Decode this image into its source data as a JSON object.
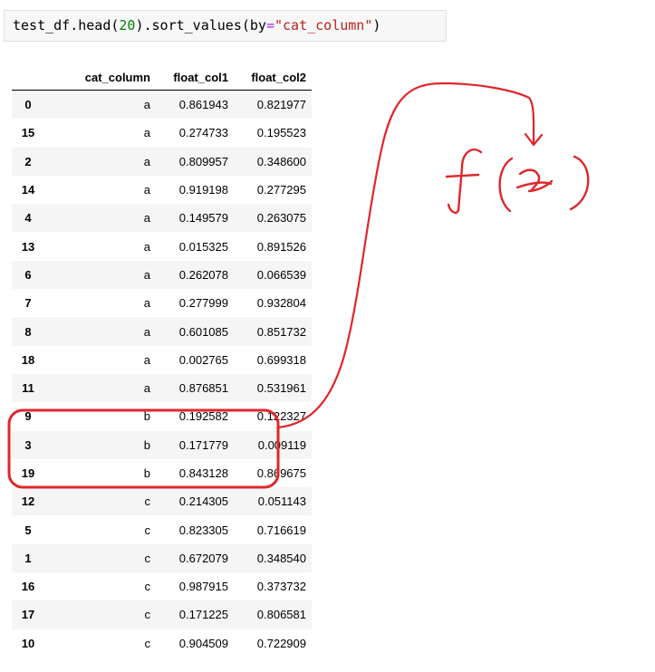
{
  "code": {
    "prefix": "test_df.head(",
    "number": "20",
    "mid": ").sort_values(by",
    "op": "=",
    "string": "\"cat_column\"",
    "suffix": ")"
  },
  "table": {
    "columns": [
      "",
      "cat_column",
      "float_col1",
      "float_col2"
    ],
    "rows": [
      {
        "index": "0",
        "cat_column": "a",
        "float_col1": "0.861943",
        "float_col2": "0.821977"
      },
      {
        "index": "15",
        "cat_column": "a",
        "float_col1": "0.274733",
        "float_col2": "0.195523"
      },
      {
        "index": "2",
        "cat_column": "a",
        "float_col1": "0.809957",
        "float_col2": "0.348600"
      },
      {
        "index": "14",
        "cat_column": "a",
        "float_col1": "0.919198",
        "float_col2": "0.277295"
      },
      {
        "index": "4",
        "cat_column": "a",
        "float_col1": "0.149579",
        "float_col2": "0.263075"
      },
      {
        "index": "13",
        "cat_column": "a",
        "float_col1": "0.015325",
        "float_col2": "0.891526"
      },
      {
        "index": "6",
        "cat_column": "a",
        "float_col1": "0.262078",
        "float_col2": "0.066539"
      },
      {
        "index": "7",
        "cat_column": "a",
        "float_col1": "0.277999",
        "float_col2": "0.932804"
      },
      {
        "index": "8",
        "cat_column": "a",
        "float_col1": "0.601085",
        "float_col2": "0.851732"
      },
      {
        "index": "18",
        "cat_column": "a",
        "float_col1": "0.002765",
        "float_col2": "0.699318"
      },
      {
        "index": "11",
        "cat_column": "a",
        "float_col1": "0.876851",
        "float_col2": "0.531961"
      },
      {
        "index": "9",
        "cat_column": "b",
        "float_col1": "0.192582",
        "float_col2": "0.122327"
      },
      {
        "index": "3",
        "cat_column": "b",
        "float_col1": "0.171779",
        "float_col2": "0.009119"
      },
      {
        "index": "19",
        "cat_column": "b",
        "float_col1": "0.843128",
        "float_col2": "0.869675"
      },
      {
        "index": "12",
        "cat_column": "c",
        "float_col1": "0.214305",
        "float_col2": "0.051143"
      },
      {
        "index": "5",
        "cat_column": "c",
        "float_col1": "0.823305",
        "float_col2": "0.716619"
      },
      {
        "index": "1",
        "cat_column": "c",
        "float_col1": "0.672079",
        "float_col2": "0.348540"
      },
      {
        "index": "16",
        "cat_column": "c",
        "float_col1": "0.987915",
        "float_col2": "0.373732"
      },
      {
        "index": "17",
        "cat_column": "c",
        "float_col1": "0.171225",
        "float_col2": "0.806581"
      },
      {
        "index": "10",
        "cat_column": "c",
        "float_col1": "0.904509",
        "float_col2": "0.722909"
      }
    ]
  },
  "annotation": {
    "color": "#e0262b",
    "highlighted_group": "b",
    "handwriting": "f(x)"
  }
}
